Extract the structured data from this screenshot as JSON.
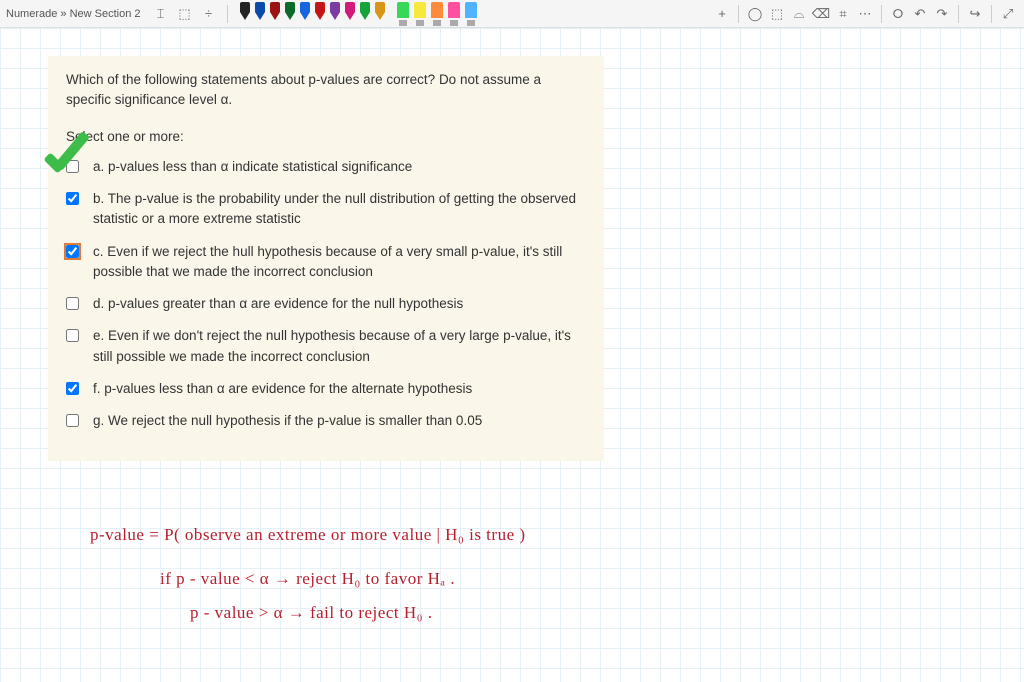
{
  "breadcrumb": "Numerade » New Section 2",
  "pen_colors": [
    "#222",
    "#0a4aa8",
    "#9b1313",
    "#0b6b2a",
    "#1766e0",
    "#c41616",
    "#7a3ca3",
    "#d11a7a",
    "#16a33a",
    "#d99518"
  ],
  "highlighter_colors": [
    "#37d85a",
    "#f7e83e",
    "#ff8a3a",
    "#ff4fa1",
    "#4fb3ff"
  ],
  "question": {
    "prompt": "Which of the following statements about p-values are correct? Do not assume a specific significance level α.",
    "select_label": "Select one or more:",
    "options": [
      {
        "letter": "a.",
        "text": "p-values less than α  indicate statistical significance",
        "checked": false
      },
      {
        "letter": "b.",
        "text": "The p-value is the probability under the null distribution of getting the observed statistic or a more extreme statistic",
        "checked": true
      },
      {
        "letter": "c.",
        "text": "Even if we reject the hull hypothesis because of a very small p-value, it's still possible that we made the incorrect conclusion",
        "checked": true,
        "highlighted": true
      },
      {
        "letter": "d.",
        "text": "p-values greater than α are evidence for the null hypothesis",
        "checked": false
      },
      {
        "letter": "e.",
        "text": "Even if we don't reject the null hypothesis because of a very large p-value, it's still possible we made the incorrect conclusion",
        "checked": false
      },
      {
        "letter": "f.",
        "text": "p-values less than α are evidence for the alternate hypothesis",
        "checked": true
      },
      {
        "letter": "g.",
        "text": "We reject the null hypothesis if the p-value is smaller than 0.05",
        "checked": false
      }
    ]
  },
  "handwriting": {
    "line1": "p-value  =  P( observe  an  extreme or  more   value  |  H₀ is  true )",
    "line2": "if  p - value   <  α  →  reject   H₀   to  favor   Hₐ .",
    "line3": "p - value   > α   →  fail to  reject  H₀ ."
  },
  "icons": {
    "text_cursor": "⌶",
    "add_shape": "⬚",
    "divide": "÷",
    "plus": "+",
    "lasso": "◯",
    "select": "⬚",
    "ruler": "⌓",
    "eraser": "⌫",
    "grid": "⌗",
    "more": "⋯",
    "bell": "⭘",
    "undo": "↶",
    "redo": "↷",
    "share": "↪",
    "fullscreen": "⤢"
  }
}
